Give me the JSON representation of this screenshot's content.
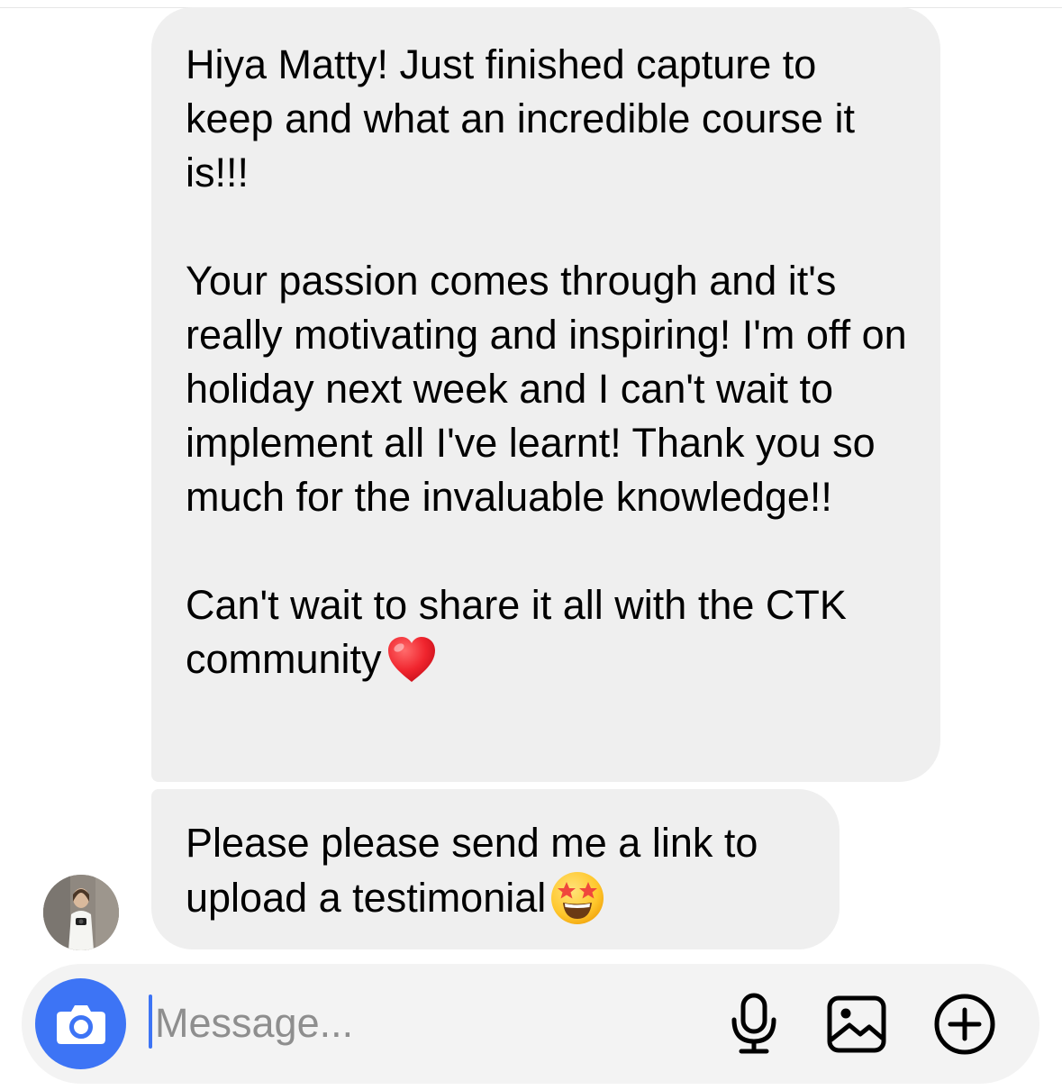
{
  "thread": {
    "messages": [
      {
        "sender": "them",
        "text": "Hiya Matty! Just finished capture to keep and what an incredible course it is!!!\n\nYour passion comes through and it's really motivating and inspiring! I'm off on holiday next week and I can't wait to implement all I've learnt! Thank you so much for the invaluable knowledge!!\n\nCan't wait to share it all with the CTK community",
        "trailing_emoji": "red-heart-icon"
      },
      {
        "sender": "them",
        "text": "Please please send me a link to upload a testimonial",
        "trailing_emoji": "star-struck-face-icon"
      }
    ]
  },
  "composer": {
    "placeholder": "Message...",
    "value": "",
    "buttons": [
      "camera-icon",
      "microphone-icon",
      "gallery-icon",
      "add-icon"
    ]
  },
  "colors": {
    "bubble": "#efefef",
    "accent": "#3d74f5",
    "composer": "#f3f3f3",
    "placeholder": "#8e8e8e"
  }
}
